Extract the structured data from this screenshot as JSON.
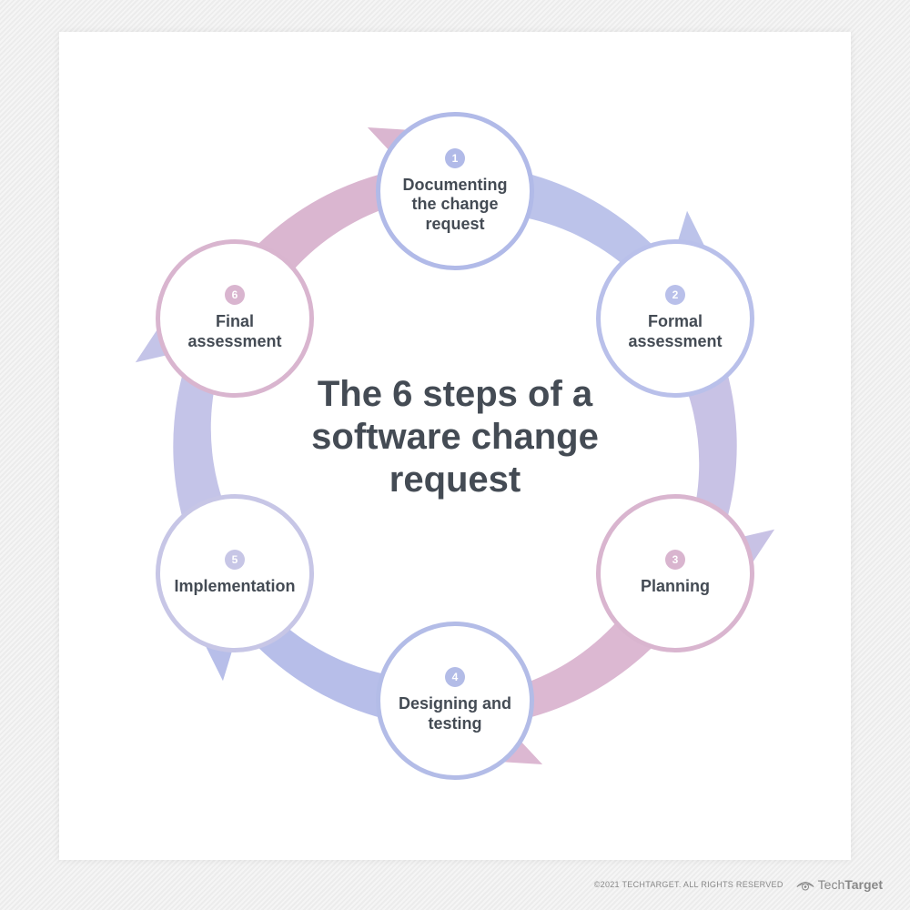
{
  "title": "The 6 steps of a software change request",
  "steps": [
    {
      "n": "1",
      "label": "Documenting the change request",
      "color": "#b1bae8",
      "numBg": "#b1bae8"
    },
    {
      "n": "2",
      "label": "Formal assessment",
      "color": "#b9c0ea",
      "numBg": "#b9c0ea"
    },
    {
      "n": "3",
      "label": "Planning",
      "color": "#d9b5cf",
      "numBg": "#d9b5cf"
    },
    {
      "n": "4",
      "label": "Designing and testing",
      "color": "#b3bce7",
      "numBg": "#b3bce7"
    },
    {
      "n": "5",
      "label": "Implementation",
      "color": "#c7c6e6",
      "numBg": "#c7c6e6"
    },
    {
      "n": "6",
      "label": "Final assessment",
      "color": "#d9b5cf",
      "numBg": "#d9b5cf"
    }
  ],
  "arrows": [
    {
      "fill": "#bcc3ea"
    },
    {
      "fill": "#c8c2e5"
    },
    {
      "fill": "#dcb8d2"
    },
    {
      "fill": "#b7bee9"
    },
    {
      "fill": "#c4c4e8"
    },
    {
      "fill": "#dab6d0"
    }
  ],
  "footer": {
    "copyright": "©2021 TECHTARGET. ALL RIGHTS RESERVED",
    "logoLight": "Tech",
    "logoBold": "Target"
  }
}
